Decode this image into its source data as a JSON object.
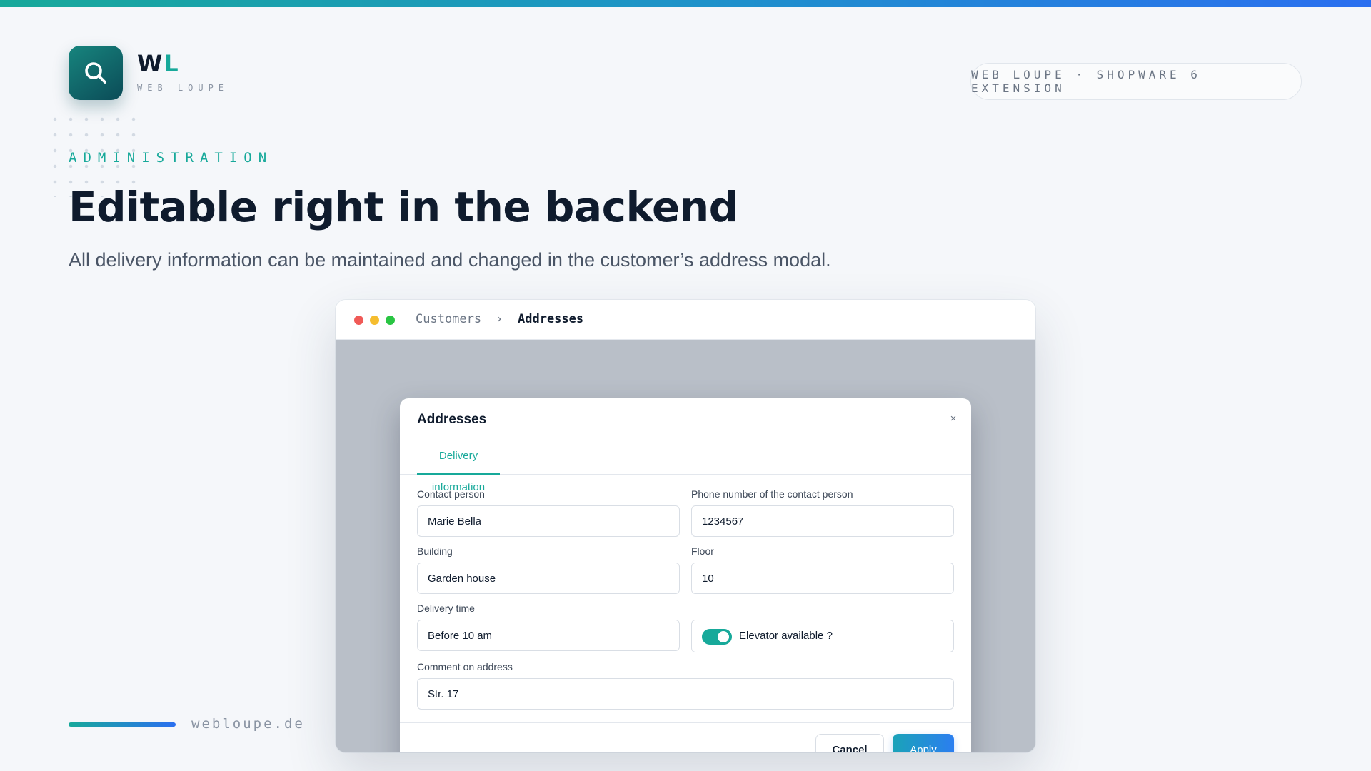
{
  "brand": {
    "mark_first": "W",
    "mark_second": "L",
    "name": "WEB LOUPE",
    "logo_icon": "search-icon",
    "badge": "WEB LOUPE · SHOPWARE 6 EXTENSION"
  },
  "hero": {
    "eyebrow": "ADMINISTRATION",
    "title": "Editable right in the backend",
    "subtitle": "All delivery information can be maintained and changed in the customer’s address modal."
  },
  "footer": {
    "url": "webloupe.de"
  },
  "window": {
    "breadcrumb": [
      "Customers",
      "›",
      "Addresses"
    ]
  },
  "modal": {
    "title": "Addresses",
    "close_label": "×",
    "tabs": [
      {
        "label": "Delivery information",
        "active": true
      }
    ],
    "fields": {
      "contact_person": {
        "label": "Contact person",
        "value": "Marie Bella"
      },
      "phone": {
        "label": "Phone number of the contact person",
        "value": "1234567"
      },
      "building": {
        "label": "Building",
        "value": "Garden house"
      },
      "floor": {
        "label": "Floor",
        "value": "10"
      },
      "delivery_time": {
        "label": "Delivery time",
        "value": "Before 10 am"
      },
      "elevator": {
        "label": "Elevator available ?",
        "checked": true
      },
      "comment": {
        "label": "Comment on address",
        "value": "Str. 17"
      }
    },
    "buttons": {
      "cancel": "Cancel",
      "apply": "Apply"
    }
  },
  "colors": {
    "accent": "#17a99a",
    "primary_text": "#0f1b2d",
    "apply_gradient_start": "#1aa3b8",
    "apply_gradient_end": "#2b7ef0"
  }
}
